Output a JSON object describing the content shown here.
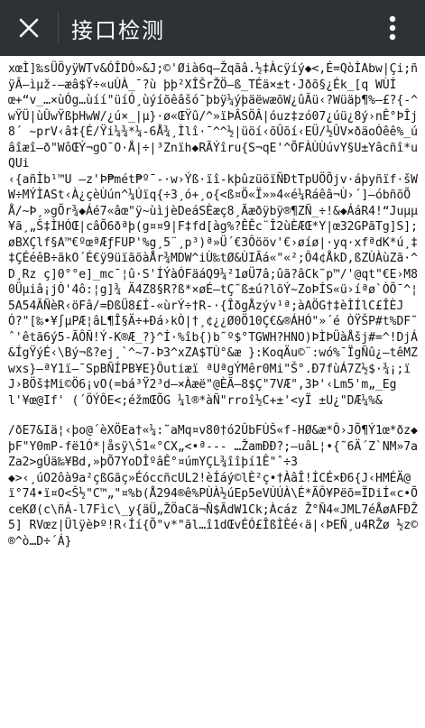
{
  "header": {
    "title": "接口检测",
    "close_icon": "close-icon",
    "more_icon": "more-vertical-icon",
    "background": "#2e3235"
  },
  "body": {
    "blocks": [
      "xœÌ]‰sÜÖyÿWTv&ÓÎDÒ»&J;©'Øià6q–Žqãâ.½‡Àcÿíý◆<,É=QòÌAbw|Çi;ñÿÂ–ìµž-—æâ$Ÿ÷«uÙÀ_¯?ù þþ²XÎŠrŽÖ—ß_TÉä×±t·Jðõ§¿Ék_[q WÙÍ\nœ+“v_…×ùÓg…ùíí\"üíÓ¸ùýíõêâšó¯þbÿ¼ýþäëwæõW¿ûÃü‹?Wüäþ¶%—£?{-^wŸÜ|ùÛwŸßþHwW/¿ú⁢×_|µ}·ø«ŒŸû/^»ïÞÂSÖÂ|óuz‡zó07¿úü¿8ý›nÊ°ÞÎj8´ ~prV‹â‡{É/Ÿi¼¾*¼-6Å¾¸Ìlî·¯^^½|üöí‹õÛõí‹EÜ/½ÛV×ðäoÓêê%_úâîæî–ð\"WôŒÝ¬gO¯O·Å|÷|³Znïh◆RÃÝîru{S¬qE'^ÕFÀÙÙúvY§U±Yâcñî*uQUi\n‹{añÌb¹™U —z'Þ₱mét₱º¯-·w›Ýß·ïî-kþûzüöïÑĐtTpUÖÕjv·áþyñïf·šWW÷MÝÌASt‹À¿çèÙún^¼Úïq{÷3¸ó+¸o{<ß¤Ö«Ï»»4«é¼Ráêâ¬Ù›´]—óbñõÕÅ/~Þ¸»gÕr¾◆Áé7«âœ\"ÿ~ùìjèDeáSÈæç8¸Ãæðÿbÿ®¶ZÑ_÷!&◆ÁáR4!“Juµµ¥ã¸„Š‡ÌHÓŒ|câÕ6ðªþ(g¤¤9|F‡fd[àg%?ÊÊc¨Î2ùÈÆŒ*Y|œ32GPãTg]S];øBXÇlf§A™€ºœªÆƒFUP'%g¸5¨¸p³)ª»Ü´€3Ôööv'€›øíø|·yq·xfªdK*ú¸‡‡ÇÉéêB÷ãkO´É€ÿ9üïãõàÅr¾MDW^iÙ‰tØ&ÙIÃá«\"«²;Ô4¢ÅkD,ßZÙÀùZã·^D¸Rz ç]0°°e]_mc¯¦û·S'ÍÝàÓFäáQ9¼²1øÜ7â;ûã?âCk˜p™/'@qt\"€E›M80Üµiâ¡jÒ'4ô:¦g]¾ Ä4Z8§R?ß*×øÉ–tÇ˜ß±ú?lõÝ~ZoÞÍS«ü›íªø`ÒÕ¯^¦ 5A54ÃÑèR‹öFâ/=ÐßÜ8£Í-«ùrÝ÷†R-·{ÎðgÅzýv¹ª;àAÖG†‡èÌÍlC£ÎÈJÓ?\"[‰•¥∫µPÆ¦âL¶Î§Ä÷+Đá›kÒ|†¸¢¿¿Ø0Ö10Ç€&®ÁHÓ\"»´é ÒŸŠP#t%DF˜ˆ'êtã6ý5-ÃÔÑ!Ý-K®Æ_?}^Í·%îb{)b˜º$°TGWH?HNO)ÞÌÞÜàÅšj#=^!DjÁ&ÍgŸýÉ‹\\Bý¬ß?ej¸`^~7-Þ3^xZA$TÙ°&æ }:KoqÄu©¨:wó%¯ÏgÑû¿—têMZwxs}—ªY1ï–¯SpBÑÍPB¥E}Ôutiæï ªUªgÝMêr0Mi\"Š°.Đ7fùÁ7Z½$·¾¡;ïJ›BÖš‡Mi©Ö6¡vO(=bá³Ÿ2³d–×Àæë\"@ÈÃ–8$Ç\"7VÆ\",3Þ'‹Lm5'm„_Egl'¥œ@If' (´ÖÝÔE<;éžmŒÕG ¼l®*àÑ\"rroî½C+±'<yÏ ±U¿\"DÆ¼%&",
      "/ðE7&Iä¦‹þo@´èXÖEa†«¼:˜aMq¤v80†ó2ÛbFÙŠ«f-HØ&æ*Ô›JÕ¶Ý1œ*ðz◆þF\"Y0mP-fë1Ó*|åsÿ\\Š1«°CX„<•ª--- …ŽamĐÐ?;–uâL¦•{˜6Ä´Z`NM»7aZa2>gÛä‰¥Bd,»þÕ7YoDÎºâÊ°¤úmYÇL¾îîþí1Ê\"ˆ÷3\n◆>‹¸úO2ôà9a²çßGãç»ÉóccñcUL2!èÍáý©lÈ²ç•†ÀâÎ!ÍCÉ×Đ6{J‹HMÉÄ@\nï°74•ï¤O<Š½\"C™„\"¤%b(Å294®ê%PÙÀ½úEp5eVÚÚÀ\\É*ÃÔ¥Pëõ=ÏDiÍ«c•ÕceKØ(c\\ñÁ-l7Fìc\\_y{äÜ„ŽÖaCä¬Ñ$ÃdW1Ck;Àcáz Ž°Ñ4«JML7éÅøAFÐŽ5] RVœz|ÜlÿèÞº!R‹Íí{Õ\"v*\"ãl…î1dŒvÉÓ£ÎßÌÈé‹ä|‹ÞEÑ¸u4RŽø ½z©®^ò…D÷´Á}"
    ]
  }
}
